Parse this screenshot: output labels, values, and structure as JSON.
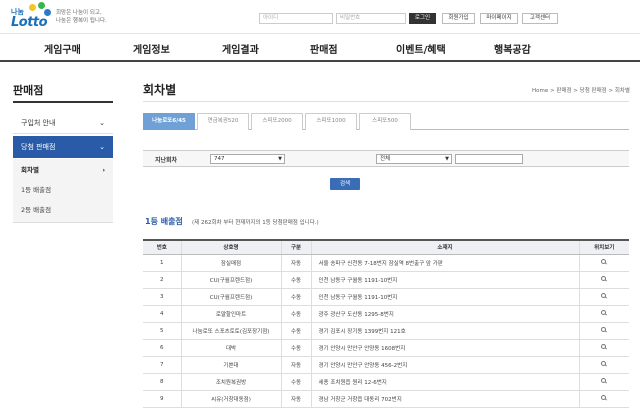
{
  "logo": {
    "top": "나눔",
    "main": "Lotto",
    "slogan_1": "희망은 나눔이 되고,",
    "slogan_2": "나눔은 행복이 됩니다."
  },
  "header": {
    "id_placeholder": "아이디",
    "pw_placeholder": "비밀번호",
    "login_label": "로그인",
    "signup_label": "회원가입",
    "mypage_label": "마이페이지",
    "support_label": "고객센터"
  },
  "gnb": [
    "게임구매",
    "게임정보",
    "게임결과",
    "판매점",
    "이벤트/혜택",
    "행복공감"
  ],
  "sidebar": {
    "title": "판매점",
    "items": [
      {
        "label": "구입처 안내"
      },
      {
        "label": "당첨 판매점"
      }
    ],
    "subitems": [
      {
        "label": "회차별"
      },
      {
        "label": "1등 배출점"
      },
      {
        "label": "2등 배출점"
      }
    ]
  },
  "main": {
    "title": "회차별",
    "breadcrumb": "Home > 판매점 > 당첨 판매점 > 회차별",
    "tabs": [
      "나눔로또6/45",
      "연금복권520",
      "스피또2000",
      "스피또1000",
      "스피또500"
    ],
    "search": {
      "label": "지난회차",
      "round_value": "747",
      "region_value": "전체",
      "button_label": "검색"
    },
    "section_title": "1등 배출점",
    "section_note": "(제 262회차 부터 현재까지의 1등 당첨판매점 입니다.)",
    "columns": [
      "번호",
      "상호명",
      "구분",
      "소재지",
      "위치보기"
    ],
    "rows": [
      {
        "no": "1",
        "name": "잠실매점",
        "type": "자동",
        "addr": "서울 송파구 신천동 7-18번지 잠실역 8번출구 앞 가판"
      },
      {
        "no": "2",
        "name": "CU(구월프렌드점)",
        "type": "수동",
        "addr": "인천 남동구 구월동 1191-10번지"
      },
      {
        "no": "3",
        "name": "CU(구월프렌드점)",
        "type": "수동",
        "addr": "인천 남동구 구월동 1191-10번지"
      },
      {
        "no": "4",
        "name": "로얄할인마트",
        "type": "수동",
        "addr": "광주 광산구 도산동 1295-8번지"
      },
      {
        "no": "5",
        "name": "나눔로또 스포츠토토(김포장기점)",
        "type": "수동",
        "addr": "경기 김포시 장기동 1399번지 121호"
      },
      {
        "no": "6",
        "name": "대박",
        "type": "수동",
        "addr": "경기 안양시 만안구 안양동 1608번지"
      },
      {
        "no": "7",
        "name": "기쁜대",
        "type": "자동",
        "addr": "경기 안양시 만안구 안양동 456-2번지"
      },
      {
        "no": "8",
        "name": "조치원복권방",
        "type": "수동",
        "addr": "세종 조치원읍 원리 12-6번지"
      },
      {
        "no": "9",
        "name": "씨유(거창대동점)",
        "type": "자동",
        "addr": "경남 거창군 거창읍 대동리 702번지"
      }
    ]
  },
  "colors": {
    "accent": "#2a5ba8",
    "tab_active": "#6fa0d6",
    "button": "#3a6db5"
  }
}
